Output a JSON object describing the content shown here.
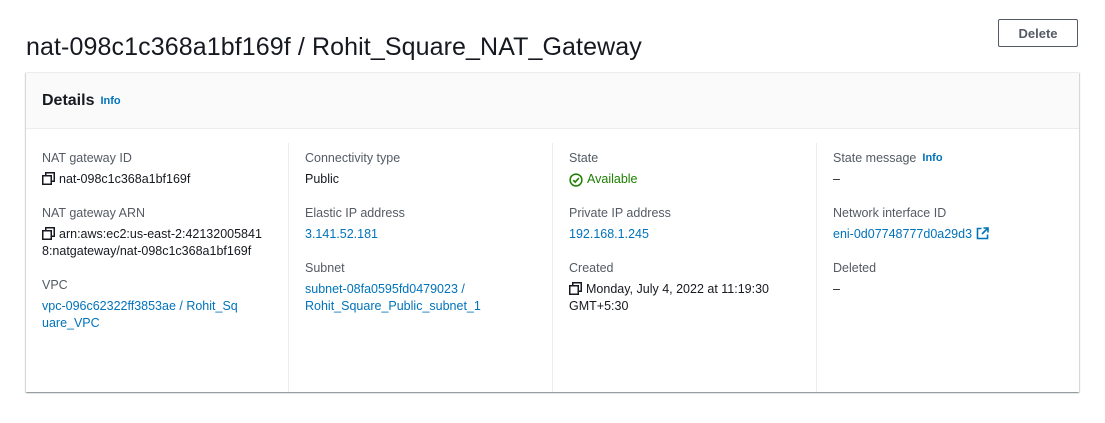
{
  "page": {
    "title": "nat-098c1c368a1bf169f / Rohit_Square_NAT_Gateway",
    "delete_label": "Delete"
  },
  "details": {
    "title": "Details",
    "info_label": "Info",
    "nat_gateway_id": {
      "label": "NAT gateway ID",
      "value": "nat-098c1c368a1bf169f"
    },
    "nat_gateway_arn": {
      "label": "NAT gateway ARN",
      "value": "arn:aws:ec2:us-east-2:421320058418:natgateway/nat-098c1c368a1bf169f"
    },
    "vpc": {
      "label": "VPC",
      "value": "vpc-096c62322ff3853ae / Rohit_Square_VPC"
    },
    "connectivity_type": {
      "label": "Connectivity type",
      "value": "Public"
    },
    "elastic_ip": {
      "label": "Elastic IP address",
      "value": "3.141.52.181"
    },
    "subnet": {
      "label": "Subnet",
      "value": "subnet-08fa0595fd0479023 / Rohit_Square_Public_subnet_1"
    },
    "state": {
      "label": "State",
      "value": "Available"
    },
    "private_ip": {
      "label": "Private IP address",
      "value": "192.168.1.245"
    },
    "created": {
      "label": "Created",
      "value": "Monday, July 4, 2022 at 11:19:30 GMT+5:30"
    },
    "state_message": {
      "label": "State message",
      "info_label": "Info",
      "value": "–"
    },
    "network_interface": {
      "label": "Network interface ID",
      "value": "eni-0d07748777d0a29d3"
    },
    "deleted": {
      "label": "Deleted",
      "value": "–"
    }
  },
  "colors": {
    "link": "#0073bb",
    "success": "#1d8102",
    "label": "#545b64",
    "text": "#16191f"
  },
  "icons": [
    "copy-icon",
    "status-available-icon",
    "external-link-icon"
  ]
}
